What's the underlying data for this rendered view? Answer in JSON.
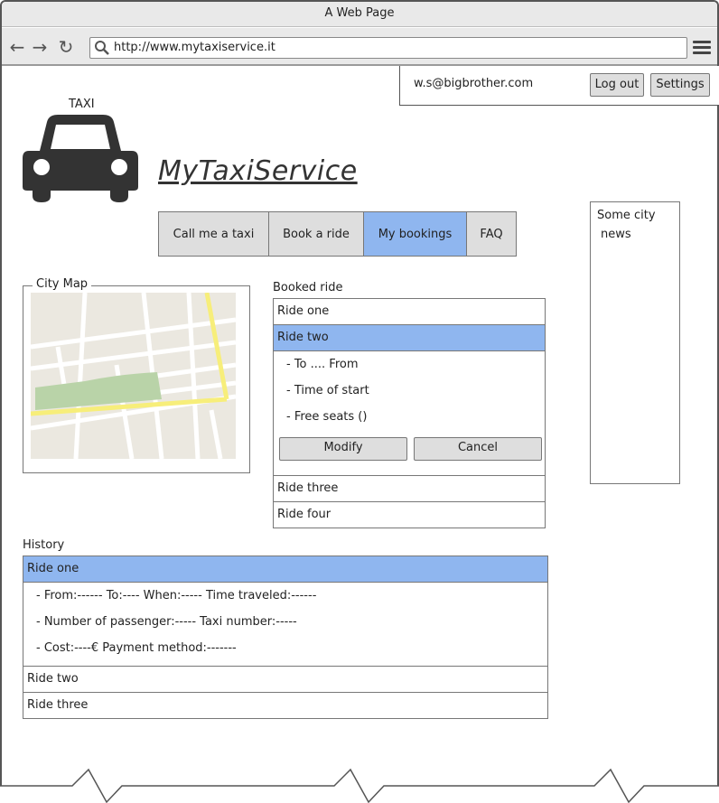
{
  "window": {
    "title": "A Web Page"
  },
  "browser": {
    "url": "http://www.mytaxiservice.it"
  },
  "user": {
    "email": "w.s@bigbrother.com",
    "logout_label": "Log out",
    "settings_label": "Settings"
  },
  "logo": {
    "caption": "TAXI"
  },
  "brand": {
    "name": "MyTaxiService"
  },
  "tabs": [
    {
      "label": "Call me a taxi"
    },
    {
      "label": "Book a ride"
    },
    {
      "label": "My bookings",
      "active": true
    },
    {
      "label": "FAQ"
    }
  ],
  "news": {
    "line1": "Some city",
    "line2": "news"
  },
  "map": {
    "legend": "City Map"
  },
  "booked": {
    "label": "Booked ride",
    "rides": [
      "Ride one",
      "Ride two",
      "Ride three",
      "Ride four"
    ],
    "selected_details": [
      "- To .... From",
      "- Time of start",
      "- Free seats ()"
    ],
    "modify_label": "Modify",
    "cancel_label": "Cancel"
  },
  "history": {
    "label": "History",
    "rides": [
      "Ride one",
      "Ride two",
      "Ride three"
    ],
    "details": [
      "- From:------  To:----  When:-----  Time traveled:------",
      "- Number of passenger:-----  Taxi number:-----",
      "- Cost:----€  Payment method:-------"
    ]
  },
  "colors": {
    "accent": "#8fb6ef",
    "button": "#dedede",
    "road": "#ffffff",
    "highway": "#f7ee7a",
    "park": "#b9d3a8",
    "land": "#ebe8e0"
  }
}
